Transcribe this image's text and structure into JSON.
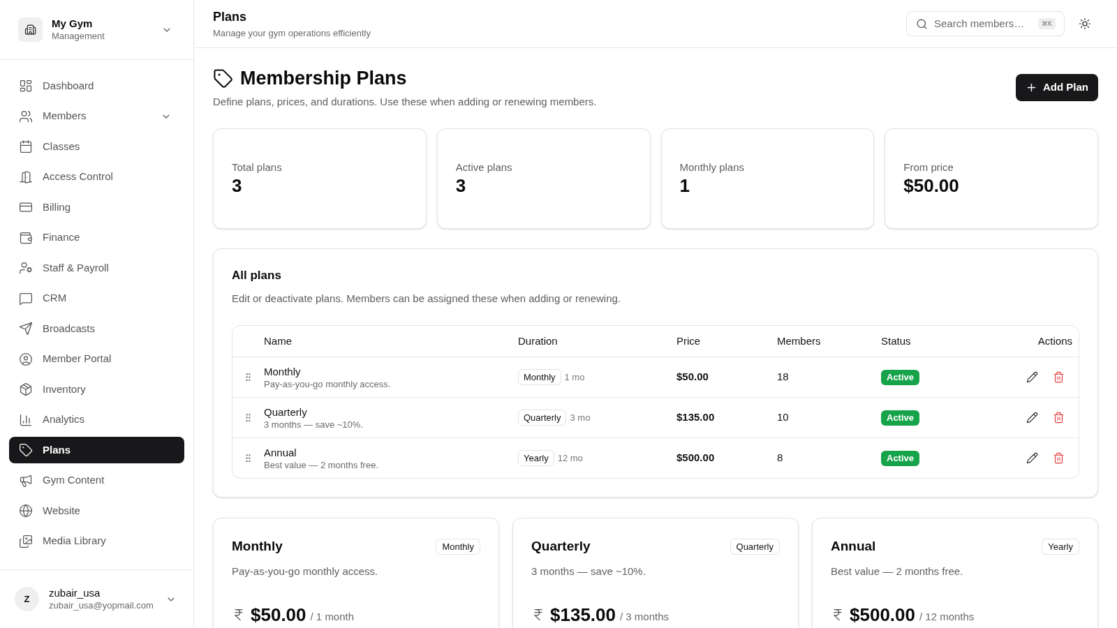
{
  "sidebar": {
    "brand": {
      "name": "My Gym",
      "subtitle": "Management"
    },
    "items": [
      {
        "label": "Dashboard",
        "selected": false,
        "submenu": false
      },
      {
        "label": "Members",
        "selected": false,
        "submenu": true
      },
      {
        "label": "Classes",
        "selected": false,
        "submenu": false
      },
      {
        "label": "Access Control",
        "selected": false,
        "submenu": false
      },
      {
        "label": "Billing",
        "selected": false,
        "submenu": false
      },
      {
        "label": "Finance",
        "selected": false,
        "submenu": false
      },
      {
        "label": "Staff & Payroll",
        "selected": false,
        "submenu": false
      },
      {
        "label": "CRM",
        "selected": false,
        "submenu": false
      },
      {
        "label": "Broadcasts",
        "selected": false,
        "submenu": false
      },
      {
        "label": "Member Portal",
        "selected": false,
        "submenu": false
      },
      {
        "label": "Inventory",
        "selected": false,
        "submenu": false
      },
      {
        "label": "Analytics",
        "selected": false,
        "submenu": false
      },
      {
        "label": "Plans",
        "selected": true,
        "submenu": false
      },
      {
        "label": "Gym Content",
        "selected": false,
        "submenu": false
      },
      {
        "label": "Website",
        "selected": false,
        "submenu": false
      },
      {
        "label": "Media Library",
        "selected": false,
        "submenu": false
      }
    ],
    "user": {
      "initial": "Z",
      "name": "zubair_usa",
      "email": "zubair_usa@yopmail.com"
    }
  },
  "header": {
    "title": "Plans",
    "subtitle": "Manage your gym operations efficiently",
    "search": {
      "placeholder": "Search members…",
      "shortcut": "⌘K"
    }
  },
  "page": {
    "title": "Membership Plans",
    "description": "Define plans, prices, and durations. Use these when adding or renewing members.",
    "add_button": "Add Plan"
  },
  "stats": [
    {
      "label": "Total plans",
      "value": "3"
    },
    {
      "label": "Active plans",
      "value": "3"
    },
    {
      "label": "Monthly plans",
      "value": "1"
    },
    {
      "label": "From price",
      "value": "$50.00"
    }
  ],
  "all_plans": {
    "title": "All plans",
    "description": "Edit or deactivate plans. Members can be assigned these when adding or renewing.",
    "columns": [
      "Name",
      "Duration",
      "Price",
      "Members",
      "Status",
      "Actions"
    ],
    "rows": [
      {
        "name": "Monthly",
        "description": "Pay-as-you-go monthly access.",
        "duration": "Monthly",
        "length": "1 mo",
        "price": "$50.00",
        "members": "18",
        "status": "Active",
        "active": true
      },
      {
        "name": "Quarterly",
        "description": "3 months — save ~10%.",
        "duration": "Quarterly",
        "length": "3 mo",
        "price": "$135.00",
        "members": "10",
        "status": "Active",
        "active": true
      },
      {
        "name": "Annual",
        "description": "Best value — 2 months free.",
        "duration": "Yearly",
        "length": "12 mo",
        "price": "$500.00",
        "members": "8",
        "status": "Active",
        "active": true
      }
    ]
  },
  "plan_cards": [
    {
      "name": "Monthly",
      "badge": "Monthly",
      "description": "Pay-as-you-go monthly access.",
      "price": "$50.00",
      "period": "/ 1 month"
    },
    {
      "name": "Quarterly",
      "badge": "Quarterly",
      "description": "3 months — save ~10%.",
      "price": "$135.00",
      "period": "/ 3 months"
    },
    {
      "name": "Annual",
      "badge": "Yearly",
      "description": "Best value — 2 months free.",
      "price": "$500.00",
      "period": "/ 12 months"
    }
  ]
}
